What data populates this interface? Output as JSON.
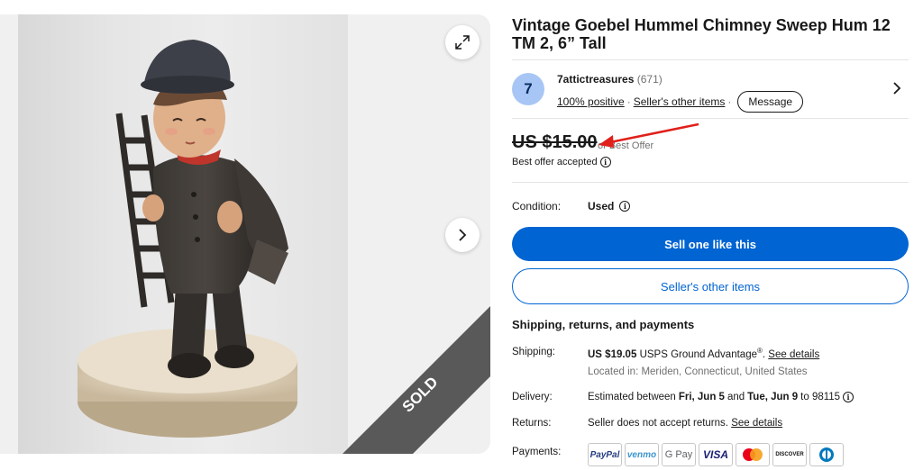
{
  "listing": {
    "title": "Vintage Goebel Hummel Chimney Sweep Hum 12 TM 2, 6” Tall",
    "sold_label": "SOLD"
  },
  "seller": {
    "initial": "7",
    "name": "7attictreasures",
    "feedback_count": "(671)",
    "positive": "100% positive",
    "other_items_link": "Seller's other items",
    "message_button": "Message"
  },
  "price": {
    "amount": "US $15.00",
    "best_offer": "or Best Offer",
    "offer_status": "Best offer accepted"
  },
  "condition": {
    "label": "Condition:",
    "value": "Used"
  },
  "buttons": {
    "sell_like": "Sell one like this",
    "seller_items": "Seller's other items"
  },
  "shipping": {
    "section_title": "Shipping, returns, and payments",
    "shipping_label": "Shipping:",
    "shipping_cost": "US $19.05",
    "shipping_service": "USPS Ground Advantage",
    "registered_mark": "®",
    "period": ".",
    "see_details": "See details",
    "location": "Located in: Meriden, Connecticut, United States",
    "delivery_label": "Delivery:",
    "delivery_prefix": "Estimated between",
    "delivery_start": "Fri, Jun 5",
    "delivery_and": "and",
    "delivery_end": "Tue, Jun 9",
    "delivery_to": "to 98115",
    "returns_label": "Returns:",
    "returns_text": "Seller does not accept returns.",
    "returns_details": "See details",
    "payments_label": "Payments:"
  },
  "payment_methods": {
    "paypal": "PayPal",
    "venmo": "venmo",
    "gpay": "G Pay",
    "visa": "VISA",
    "discover": "DISCOVER"
  },
  "colors": {
    "accent": "#0064d2",
    "annotation_arrow": "#e0201b",
    "sold_banner": "#595959"
  }
}
